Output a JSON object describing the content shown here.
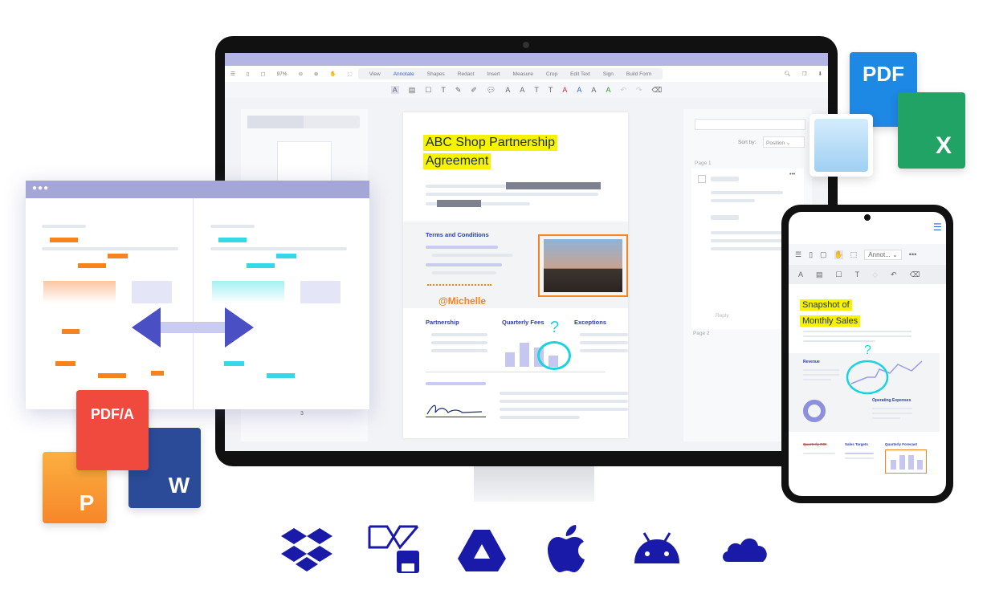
{
  "toolbar": {
    "zoom": "97%",
    "tabs": [
      "View",
      "Annotate",
      "Shapes",
      "Redact",
      "Insert",
      "Measure",
      "Crop",
      "Edit Text",
      "Sign",
      "Build Form"
    ],
    "active_tab": "Annotate"
  },
  "left_panel": {
    "page_number": "3"
  },
  "document": {
    "title_line1": "ABC Shop Partnership",
    "title_line2": "Agreement",
    "terms": "Terms and Conditions",
    "mention": "@Michelle",
    "col1": "Partnership",
    "col2": "Quarterly Fees",
    "col3": "Exceptions",
    "question_mark": "?"
  },
  "comments_panel": {
    "sort_label": "Sort by:",
    "sort_value": "Position",
    "page1": "Page 1",
    "page2": "Page 2",
    "reply": "Reply",
    "more": "•••"
  },
  "file_icons": {
    "pdf": "PDF",
    "excel": "X",
    "pdfa": "PDF/A",
    "word": "W",
    "ppt": "P"
  },
  "phone": {
    "mode_select": "Annot...",
    "title_line1": "Snapshot of",
    "title_line2": "Monthly Sales",
    "revenue": "Revenue",
    "operating": "Operating Expenses",
    "roi": "Quarterly ROI",
    "targets": "Sales Targets",
    "forecast": "Quarterly Forecast",
    "question_mark": "?"
  },
  "services": [
    "dropbox-icon",
    "file-sync-icon",
    "google-drive-icon",
    "apple-icon",
    "android-icon",
    "onedrive-icon"
  ],
  "colors": {
    "accent": "#3b5fcf",
    "highlight": "#f6f200",
    "orange": "#f7831f",
    "cyan": "#19d3e0",
    "service": "#1a1aa8",
    "pdf_blue": "#1e88e5",
    "excel_green": "#21a366",
    "pdfa_red": "#f0493e",
    "word_blue": "#2b4a97",
    "ppt_orange": "#f7862a"
  }
}
